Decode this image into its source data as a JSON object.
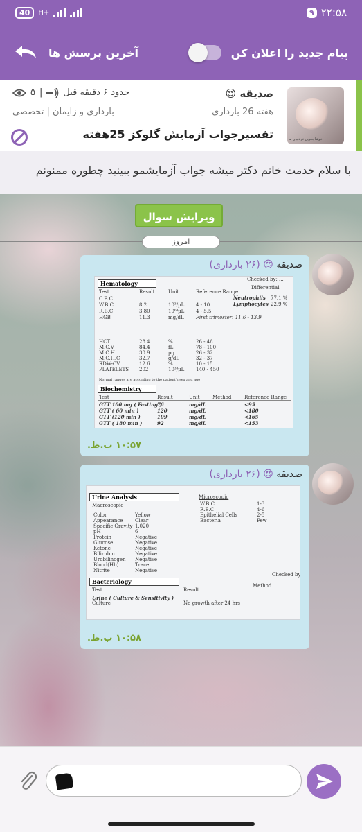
{
  "status_bar": {
    "time": "۲۲:۵۸",
    "notification_count": "۹",
    "battery": "40",
    "network": "H+"
  },
  "toolbar": {
    "announce_label": "پیام جدید را اعلان کن",
    "last_questions_label": "آخرین پرسش ها",
    "toggle_on": false
  },
  "question": {
    "author": "صدیقه",
    "author_emoji": "😍",
    "week": "هفته 26 بارداری",
    "title": "تفسیرجواب آزمایش گلوکز 25هفته",
    "time_ago": "حدود ۶ دقیقه قبل",
    "views": "۵",
    "category": "بارداری و زایمان | تخصصی",
    "avatar_text": "خوشا بحرین تو دنیای ما",
    "body": "با سلام خدمت خانم دکتر میشه جواب آزمایشمو ببینید چطوره ممنونم"
  },
  "chat": {
    "edit_button": "ویرایش سوال",
    "date_label": "امروز",
    "messages": [
      {
        "author": "صدیقه",
        "emoji": "😍",
        "meta": "(۲۶ بارداری)",
        "time": "۱۰:۵۷ ب.ظ."
      },
      {
        "author": "صدیقه",
        "emoji": "😍",
        "meta": "(۲۶ بارداری)",
        "time": "۱۰:۵۸ ب.ظ."
      }
    ]
  },
  "lab1": {
    "hematology_title": "Hematology",
    "hema_cols": [
      "Test",
      "Result",
      "Unit",
      "Reference Range",
      "Differential"
    ],
    "hema_rows": [
      [
        "C.B.C",
        "",
        "",
        ""
      ],
      [
        "W.B.C",
        "8.2",
        "10³/µL",
        "4 - 10"
      ],
      [
        "R.B.C",
        "3.80",
        "10⁶/µL",
        "4 - 5.5"
      ],
      [
        "HGB",
        "11.3",
        "mg/dL",
        "First trimester: 11.6 - 13.9"
      ],
      [
        "HCT",
        "28.4",
        "%",
        "26 - 46"
      ],
      [
        "M.C.V",
        "84.4",
        "fL",
        "78 - 100"
      ],
      [
        "M.C.H",
        "30.9",
        "pg",
        "26 - 32"
      ],
      [
        "M.C.H.C",
        "32.7",
        "g/dL",
        "32 - 37"
      ],
      [
        "RDW-CV",
        "12.6",
        "%",
        "10 - 15"
      ],
      [
        "PLATELETS",
        "202",
        "10³/µL",
        "140 - 450"
      ]
    ],
    "differential": [
      [
        "Neutrophils",
        "77.1 %"
      ],
      [
        "Lymphocytes",
        "22.9 %"
      ]
    ],
    "biochem_title": "Biochemistry",
    "bio_cols": [
      "Test",
      "Result",
      "Unit",
      "Method",
      "Reference Range"
    ],
    "bio_rows": [
      [
        "GTT 100 mg ( Fasting )",
        "76",
        "mg/dL",
        "<95"
      ],
      [
        "GTT ( 60 min )",
        "120",
        "mg/dL",
        "<180"
      ],
      [
        "GTT (120 min )",
        "109",
        "mg/dL",
        "<165"
      ],
      [
        "GTT ( 180 min )",
        "92",
        "mg/dL",
        "<153"
      ]
    ],
    "footnote": "Normal ranges are according to the patient's sex and age",
    "checked_by": "Checked by: ..."
  },
  "lab2": {
    "urine_title": "Urine Analysis",
    "macroscopic": "Macroscopic",
    "microscopic": "Microscopic",
    "urine_rows": [
      [
        "Color",
        "Yellow"
      ],
      [
        "Appearance",
        "Clear"
      ],
      [
        "Specific Gravity",
        "1.020"
      ],
      [
        "pH",
        "6"
      ],
      [
        "Protein",
        "Negative"
      ],
      [
        "Glucose",
        "Negative"
      ],
      [
        "Ketone",
        "Negative"
      ],
      [
        "Bilirubin",
        "Negative"
      ],
      [
        "Urobilinogen",
        "Negative"
      ],
      [
        "Blood(Hb)",
        "Trace"
      ],
      [
        "Nitrite",
        "Negative"
      ]
    ],
    "micro_rows": [
      [
        "W.B.C",
        "1-3"
      ],
      [
        "R.B.C",
        "4-6"
      ],
      [
        "Epithelial Cells",
        "2-5"
      ],
      [
        "Bacteria",
        "Few"
      ]
    ],
    "bacteriology_title": "Bacteriology",
    "bact_cols": [
      "Test",
      "Result",
      "Method"
    ],
    "bact_rows": [
      [
        "Urine ( Culture & Sensitivity )"
      ],
      [
        "Culture",
        "No growth after 24 hrs"
      ]
    ],
    "checked_by": "Checked by"
  },
  "input": {
    "placeholder": ""
  },
  "colors": {
    "primary": "#8e63b6",
    "accent_green": "#8bc34a",
    "bubble": "#c9e7f0"
  }
}
